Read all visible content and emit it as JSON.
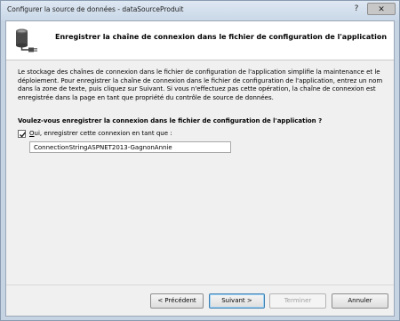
{
  "window": {
    "title": "Configurer la source de données - dataSourceProduit",
    "help_glyph": "?",
    "close_glyph": "✕"
  },
  "header": {
    "icon": "database-connection-icon",
    "title": "Enregistrer la chaîne de connexion dans le fichier de configuration de l'application"
  },
  "description": "Le stockage des chaînes de connexion dans le fichier de configuration de l'application simplifie la maintenance et le déploiement. Pour enregistrer la chaîne de connexion dans le fichier de configuration de l'application, entrez un nom dans la zone de texte, puis cliquez sur Suivant. Si vous n'effectuez pas cette opération, la chaîne de connexion est enregistrée dans la page en tant que propriété du contrôle de source de données.",
  "question": "Voulez-vous enregistrer la connexion dans le fichier de configuration de l'application ?",
  "save_option": {
    "checked": true,
    "label_mnemonic": "O",
    "label_rest": "ui, enregistrer cette connexion en tant que :",
    "value": "ConnectionStringASPNET2013-GagnonAnnie"
  },
  "buttons": {
    "previous": "< Précédent",
    "next": "Suivant >",
    "finish": "Terminer",
    "cancel": "Annuler"
  },
  "colors": {
    "title_bar": "#c9d7e7",
    "dialog_background": "#f0f0f0",
    "header_background": "#ffffff",
    "default_button_border": "#3c7fb1"
  }
}
